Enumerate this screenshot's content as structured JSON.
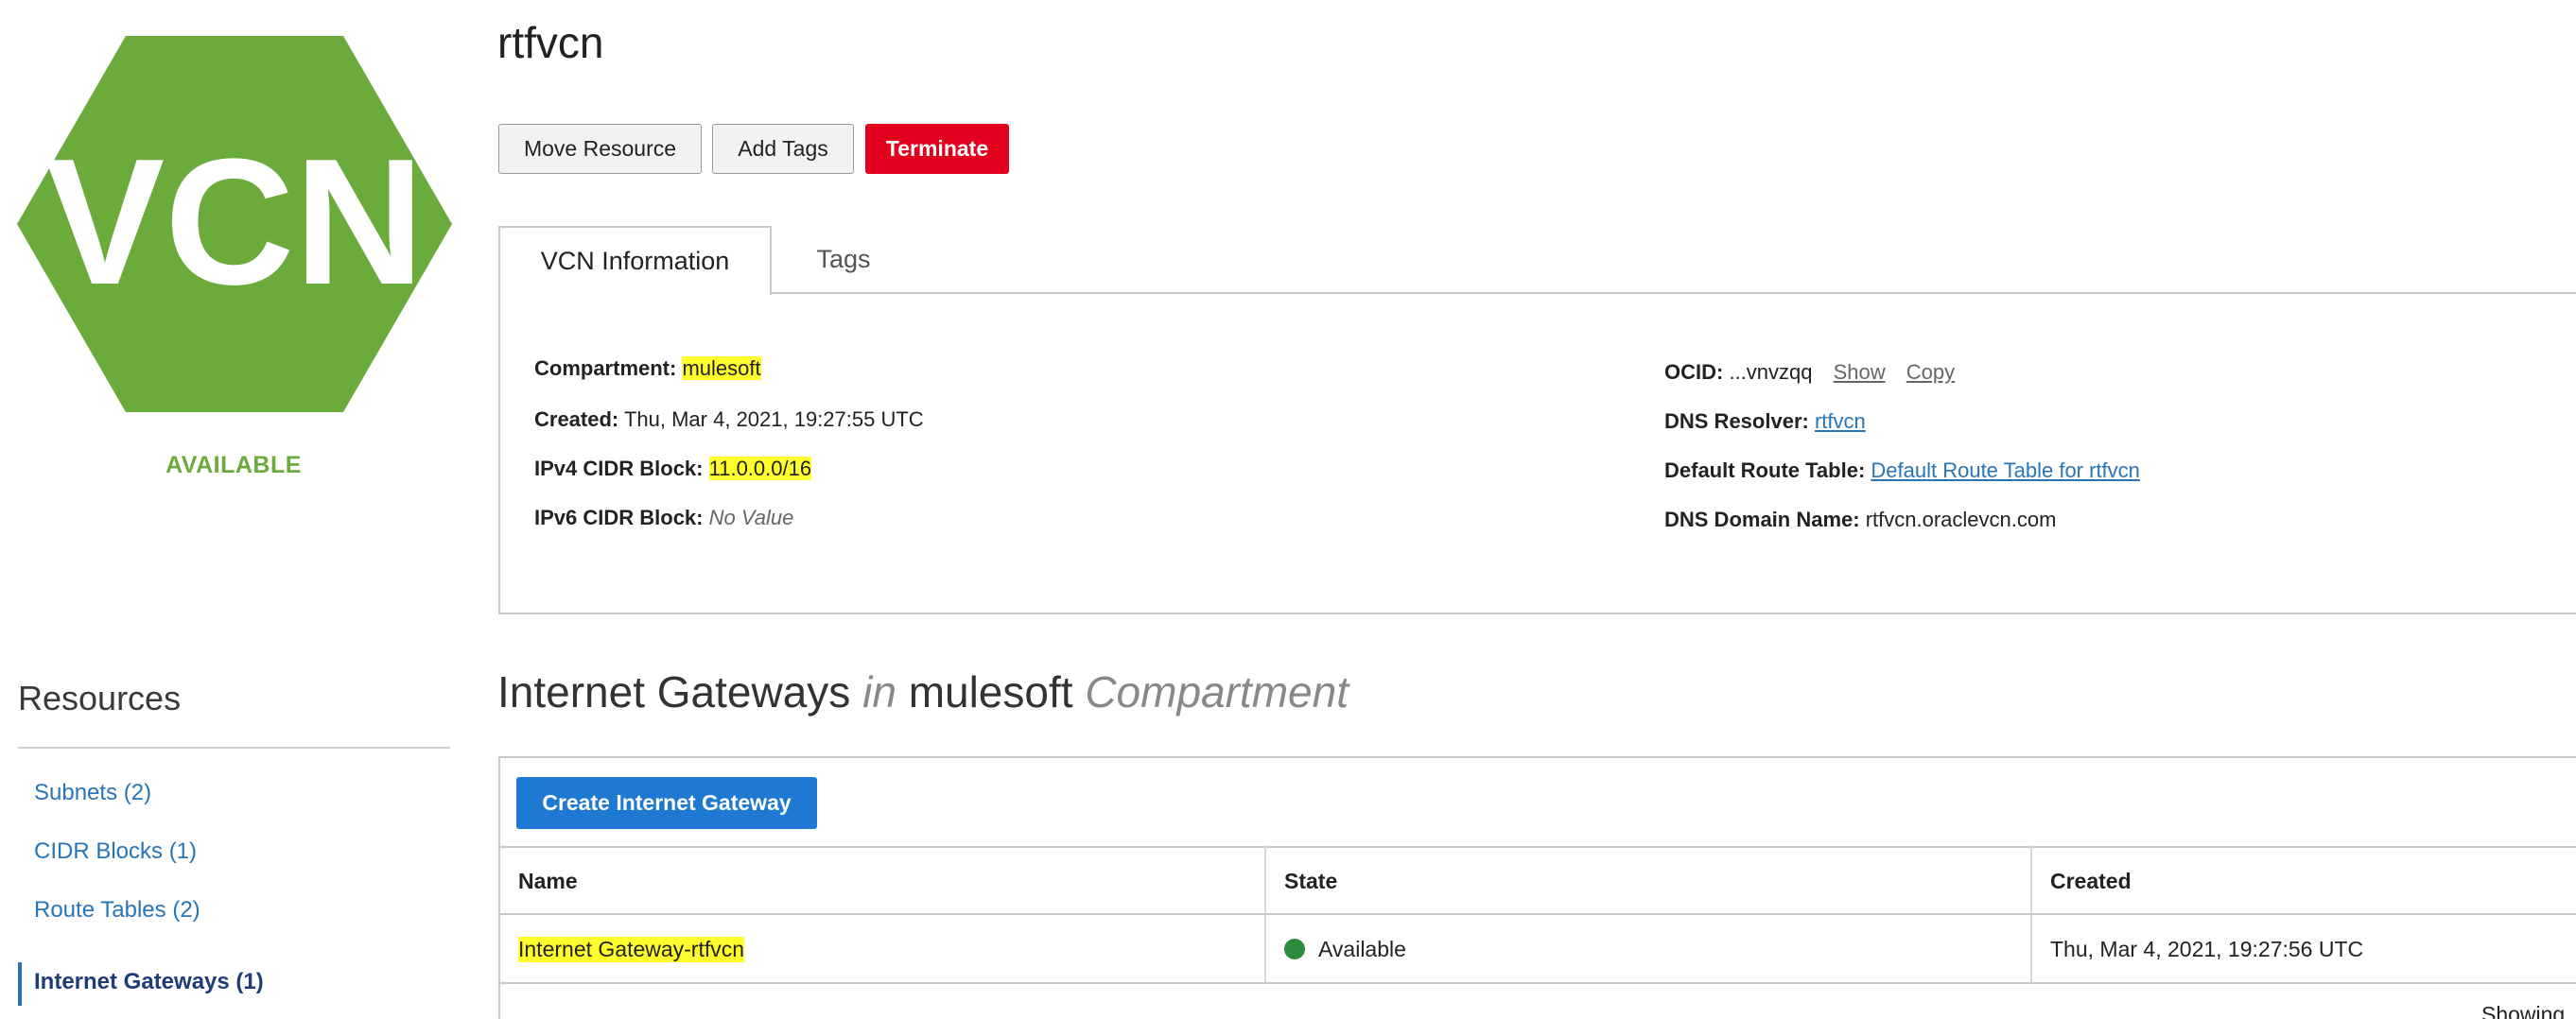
{
  "vcn_badge": {
    "text": "VCN",
    "color": "#6bab3c",
    "status": "AVAILABLE"
  },
  "header": {
    "title": "rtfvcn",
    "buttons": {
      "move": "Move Resource",
      "add_tags": "Add Tags",
      "terminate": "Terminate"
    }
  },
  "tabs": [
    {
      "label": "VCN Information",
      "active": true
    },
    {
      "label": "Tags",
      "active": false
    }
  ],
  "info": {
    "compartment_label": "Compartment:",
    "compartment_value": "mulesoft",
    "created_label": "Created:",
    "created_value": "Thu, Mar 4, 2021, 19:27:55 UTC",
    "ipv4_label": "IPv4 CIDR Block:",
    "ipv4_value": "11.0.0.0/16",
    "ipv6_label": "IPv6 CIDR Block:",
    "ipv6_value": "No Value",
    "ocid_label": "OCID:",
    "ocid_value": "...vnvzqq",
    "ocid_show": "Show",
    "ocid_copy": "Copy",
    "dns_resolver_label": "DNS Resolver:",
    "dns_resolver_value": "rtfvcn",
    "route_table_label": "Default Route Table:",
    "route_table_value": "Default Route Table for rtfvcn",
    "dns_domain_label": "DNS Domain Name:",
    "dns_domain_value": "rtfvcn.oraclevcn.com"
  },
  "resources": {
    "title": "Resources",
    "items": [
      {
        "label": "Subnets (2)",
        "active": false
      },
      {
        "label": "CIDR Blocks (1)",
        "active": false
      },
      {
        "label": "Route Tables (2)",
        "active": false
      },
      {
        "label": "Internet Gateways (1)",
        "active": true
      }
    ]
  },
  "section": {
    "title_a": "Internet Gateways",
    "title_in": "in",
    "title_b": "mulesoft",
    "title_c": "Compartment",
    "create_button": "Create Internet Gateway",
    "columns": [
      "Name",
      "State",
      "Created"
    ],
    "rows": [
      {
        "name": "Internet Gateway-rtfvcn",
        "state": "Available",
        "created": "Thu, Mar 4, 2021, 19:27:56 UTC"
      }
    ],
    "footer": "Showing"
  },
  "colors": {
    "terminate": "#e1001d",
    "primary": "#1e79d2",
    "link": "#2874b8",
    "available_dot": "#2e8b3d",
    "highlight": "#ffff2e"
  }
}
